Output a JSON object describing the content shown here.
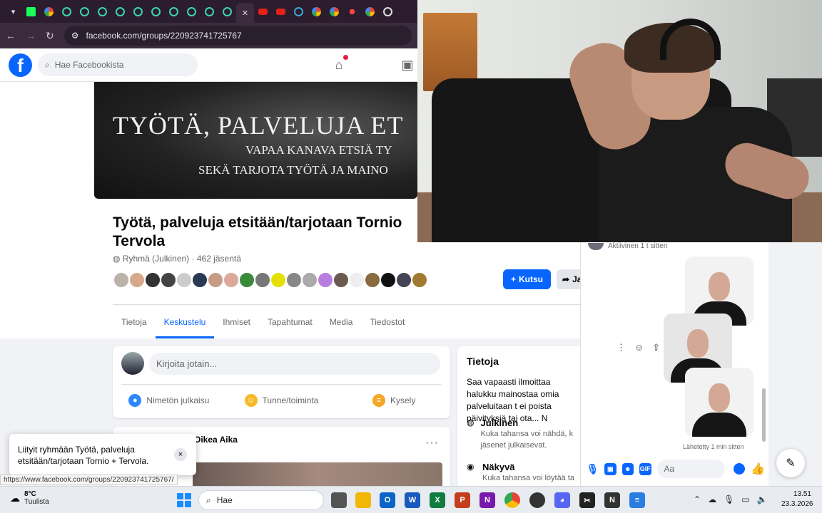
{
  "browser": {
    "url": "facebook.com/groups/220923741725767",
    "tab_icons": [
      "chevron-down-icon",
      "k-favicon",
      "google-favicon",
      "bookmark-favicon",
      "bookmark-favicon",
      "bookmark-favicon",
      "bookmark-favicon",
      "bookmark-favicon",
      "bookmark-favicon",
      "bookmark-favicon",
      "bookmark-favicon",
      "bookmark-favicon",
      "close-icon",
      "youtube-favicon",
      "youtube-favicon",
      "circle-favicon",
      "google-favicon",
      "google-favicon",
      "dots-favicon",
      "google-favicon",
      "shield-favicon"
    ]
  },
  "fb": {
    "logo": "f",
    "search_placeholder": "Hae Facebookista"
  },
  "group": {
    "cover_line1": "TYÖTÄ, PALVELUJA ET",
    "cover_line2": "VAPAA KANAVA ETSIÄ TY",
    "cover_line3": "SEKÄ TARJOTA TYÖTÄ JA MAINO",
    "title": "Työtä, palveluja etsitään/tarjotaan Tornio Tervola",
    "meta": "Ryhmä (Julkinen) · 462 jäsentä",
    "invite_label": "Kutsu",
    "share_label": "Ja",
    "tabs": [
      "Tietoja",
      "Keskustelu",
      "Ihmiset",
      "Tapahtumat",
      "Media",
      "Tiedostot"
    ],
    "active_tab": "Keskustelu"
  },
  "composer": {
    "placeholder": "Kirjoita jotain...",
    "actions": [
      "Nimetön julkaisu",
      "Tunne/toiminta",
      "Kysely"
    ]
  },
  "post": {
    "author": "Oikea Aika",
    "more": "···"
  },
  "about": {
    "title": "Tietoja",
    "description": "Saa vapaasti ilmoittaa halukku mainostaa omia palveluitaan t ei poista päivityksiä tai ota... N",
    "public_title": "Julkinen",
    "public_sub": "Kuka tahansa voi nähdä, k jäsenet julkaisevat.",
    "visible_title": "Näkyvä",
    "visible_sub": "Kuka tahansa voi löytää ta"
  },
  "toast": {
    "message": "Liityit ryhmään Työtä, palveluja etsitään/tarjotaan Tornio + Tervola.",
    "close": "×"
  },
  "status_url": "https://www.facebook.com/groups/220923741725767/",
  "chat": {
    "active_status": "Aktiivinen 1 t sitten",
    "sent_status": "Lähetetty 1 min sitten",
    "input_placeholder": "Aa"
  },
  "taskbar": {
    "temperature": "8°C",
    "condition": "Tuulista",
    "search_label": "Hae",
    "time": "13.51",
    "date": "23.3.2026"
  },
  "colors": {
    "facebook_blue": "#0866ff",
    "browser_frame": "#2b1d2e"
  }
}
